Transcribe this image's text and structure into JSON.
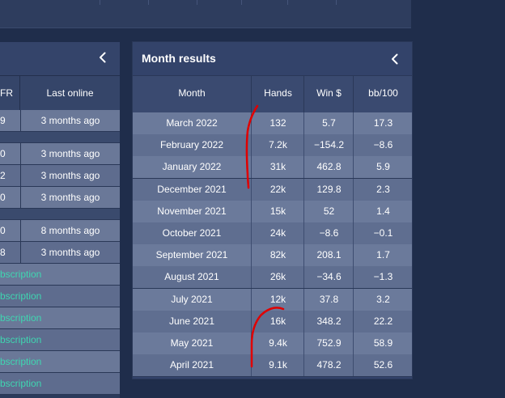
{
  "left_panel": {
    "columns": [
      "FR",
      "Last online"
    ],
    "rows": [
      {
        "type": "data",
        "v1": "9",
        "v2": "3 months ago"
      },
      {
        "type": "gap"
      },
      {
        "type": "data",
        "v1": "0",
        "v2": "3 months ago"
      },
      {
        "type": "data",
        "v1": "2",
        "v2": "3 months ago"
      },
      {
        "type": "data",
        "v1": "0",
        "v2": "3 months ago"
      },
      {
        "type": "gap"
      },
      {
        "type": "data",
        "v1": "0",
        "v2": "8 months ago"
      },
      {
        "type": "data",
        "v1": "8",
        "v2": "3 months ago"
      },
      {
        "type": "sub",
        "text": "bscription"
      },
      {
        "type": "sub",
        "text": "bscription"
      },
      {
        "type": "sub",
        "text": "bscription"
      },
      {
        "type": "sub",
        "text": "bscription"
      },
      {
        "type": "sub",
        "text": "bscription"
      },
      {
        "type": "sub",
        "text": "bscription"
      }
    ]
  },
  "month_panel": {
    "title": "Month results",
    "columns": [
      "Month",
      "Hands",
      "Win $",
      "bb/100"
    ],
    "rows": [
      {
        "month": "March 2022",
        "hands": "132",
        "win": "5.7",
        "bb": "17.3"
      },
      {
        "month": "February 2022",
        "hands": "7.2k",
        "win": "−154.2",
        "bb": "−8.6"
      },
      {
        "month": "January 2022",
        "hands": "31k",
        "win": "462.8",
        "bb": "5.9"
      },
      {
        "month": "December 2021",
        "hands": "22k",
        "win": "129.8",
        "bb": "2.3"
      },
      {
        "month": "November 2021",
        "hands": "15k",
        "win": "52",
        "bb": "1.4"
      },
      {
        "month": "October 2021",
        "hands": "24k",
        "win": "−8.6",
        "bb": "−0.1"
      },
      {
        "month": "September 2021",
        "hands": "82k",
        "win": "208.1",
        "bb": "1.7"
      },
      {
        "month": "August 2021",
        "hands": "26k",
        "win": "−34.6",
        "bb": "−1.3"
      },
      {
        "month": "July 2021",
        "hands": "12k",
        "win": "37.8",
        "bb": "3.2"
      },
      {
        "month": "June 2021",
        "hands": "16k",
        "win": "348.2",
        "bb": "22.2"
      },
      {
        "month": "May 2021",
        "hands": "9.4k",
        "win": "752.9",
        "bb": "58.9"
      },
      {
        "month": "April 2021",
        "hands": "9.1k",
        "win": "478.2",
        "bb": "52.6"
      }
    ]
  },
  "colors": {
    "background": "#1f2d4b",
    "accent_teal": "#3fd6b1",
    "annotation_red": "#e00000"
  },
  "icons": {
    "collapse": "chevron-left-icon"
  }
}
